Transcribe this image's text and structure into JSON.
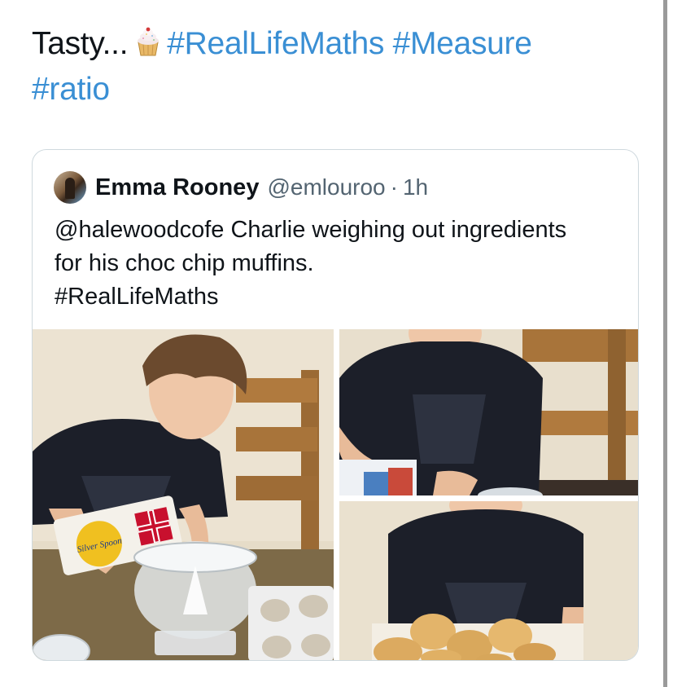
{
  "tweet": {
    "text_prefix": "Tasty...",
    "emoji": "cupcake-icon",
    "hashtags": [
      "#RealLifeMaths",
      "#Measure",
      "#ratio"
    ]
  },
  "quote": {
    "author_name": "Emma Rooney",
    "author_handle": "@emlouroo",
    "separator": "·",
    "time": "1h",
    "mention": "@halewoodcofe",
    "body_line1": " Charlie weighing out ingredients",
    "body_line2": "for his choc chip muffins.",
    "hashtag": "#RealLifeMaths",
    "bag_label": "Silver Spoon"
  },
  "colors": {
    "link": "#3a8fd4",
    "text": "#0f1419",
    "secondary": "#536471",
    "border": "#cfd9de"
  }
}
